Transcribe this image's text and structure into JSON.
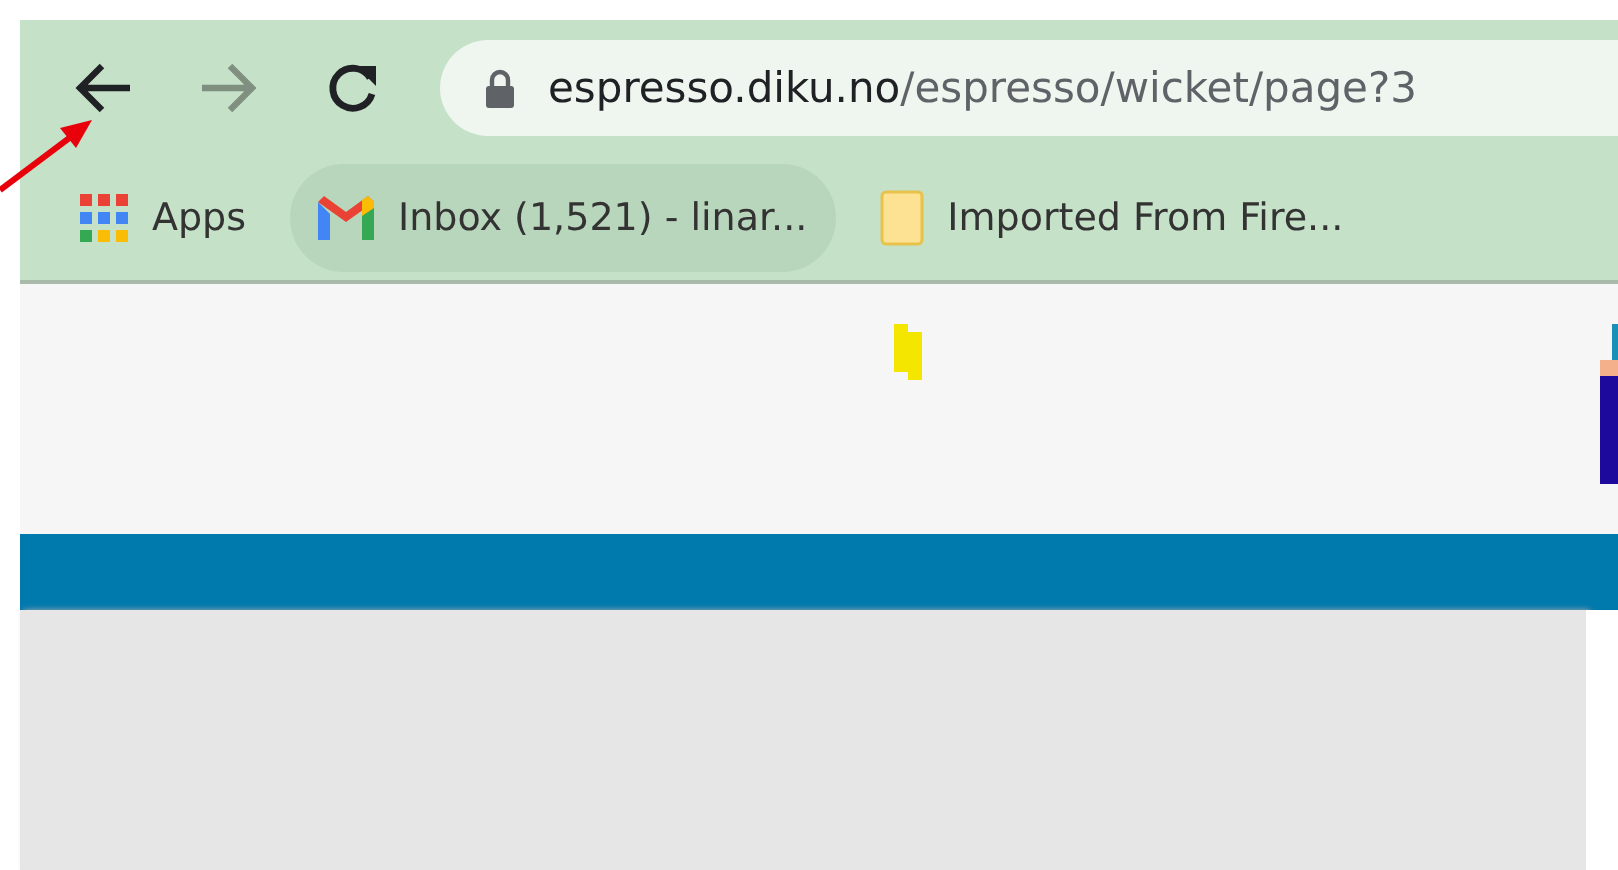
{
  "toolbar": {
    "nav_buttons": [
      {
        "kind": "back",
        "disabled": false
      },
      {
        "kind": "forward",
        "disabled": true
      },
      {
        "kind": "reload",
        "disabled": false
      }
    ],
    "address": {
      "host": "espresso.diku.no",
      "path": "/espresso/wicket/page?3"
    }
  },
  "bookmarks": [
    {
      "kind": "apps",
      "label": "Apps",
      "selected": false
    },
    {
      "kind": "mail",
      "label": "Inbox (1,521) - linar...",
      "selected": true
    },
    {
      "kind": "folder",
      "label": "Imported From Fire...",
      "selected": false
    }
  ]
}
